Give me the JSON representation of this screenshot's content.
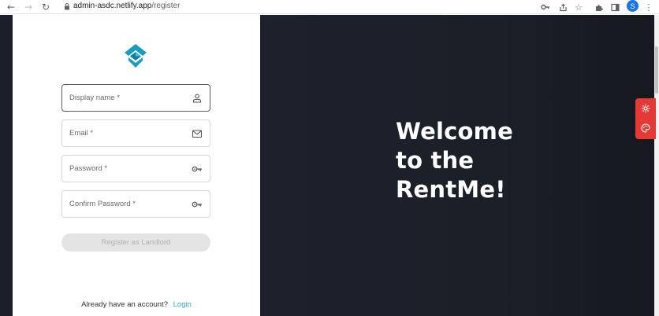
{
  "browser": {
    "url_host": "admin-asdc.netlify.app",
    "url_path": "/register",
    "profile_initial": "S"
  },
  "form": {
    "display_name_placeholder": "Display name *",
    "email_placeholder": "Email *",
    "password_placeholder": "Password *",
    "confirm_password_placeholder": "Confirm Password *",
    "register_label": "Register as Landlord",
    "account_prompt": "Already have an account?",
    "login_label": "Login"
  },
  "hero": {
    "line1": "Welcome",
    "line2": "to the",
    "line3": "RentMe!"
  },
  "colors": {
    "accent": "#2fa8c8",
    "logo_primary": "#1a9cc0",
    "hero_bg": "#1b1f29",
    "widget": "#e53935"
  }
}
